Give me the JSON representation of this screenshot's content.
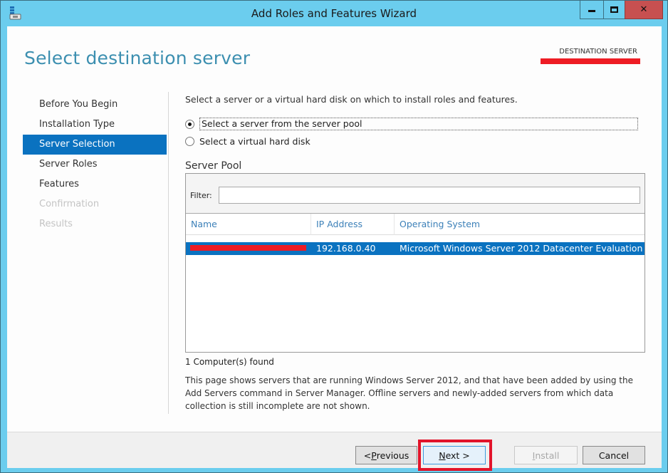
{
  "window": {
    "title": "Add Roles and Features Wizard",
    "icons": {
      "app": "server-manager-icon",
      "minimize": "minimize-icon",
      "maximize": "maximize-icon",
      "close": "close-icon"
    }
  },
  "header": {
    "page_title": "Select destination server",
    "destination_label": "DESTINATION SERVER",
    "destination_value": "[redacted]"
  },
  "nav": {
    "items": [
      {
        "label": "Before You Begin",
        "state": "normal"
      },
      {
        "label": "Installation Type",
        "state": "normal"
      },
      {
        "label": "Server Selection",
        "state": "active"
      },
      {
        "label": "Server Roles",
        "state": "normal"
      },
      {
        "label": "Features",
        "state": "normal"
      },
      {
        "label": "Confirmation",
        "state": "disabled"
      },
      {
        "label": "Results",
        "state": "disabled"
      }
    ]
  },
  "content": {
    "instruction": "Select a server or a virtual hard disk on which to install roles and features.",
    "options": [
      {
        "label": "Select a server from the server pool",
        "checked": true
      },
      {
        "label": "Select a virtual hard disk",
        "checked": false
      }
    ],
    "server_pool": {
      "heading": "Server Pool",
      "filter_label": "Filter:",
      "filter_value": "",
      "columns": [
        "Name",
        "IP Address",
        "Operating System"
      ],
      "rows": [
        {
          "name": "[redacted]",
          "ip": "192.168.0.40",
          "os": "Microsoft Windows Server 2012 Datacenter Evaluation",
          "selected": true
        }
      ]
    },
    "found_count": "1 Computer(s) found",
    "note": "This page shows servers that are running Windows Server 2012, and that have been added by using the Add Servers command in Server Manager. Offline servers and newly-added servers from which data collection is still incomplete are not shown."
  },
  "footer": {
    "previous": {
      "prefix": "< ",
      "mnemonic": "P",
      "rest": "revious"
    },
    "next": {
      "mnemonic": "N",
      "rest": "ext >"
    },
    "install": {
      "mnemonic": "I",
      "rest": "nstall"
    },
    "cancel": "Cancel"
  },
  "colors": {
    "title_bar": "#6bcdee",
    "accent": "#0a72c0",
    "page_title": "#3c8fb0",
    "close_button": "#c75050",
    "annotation_red": "#e2142a"
  }
}
